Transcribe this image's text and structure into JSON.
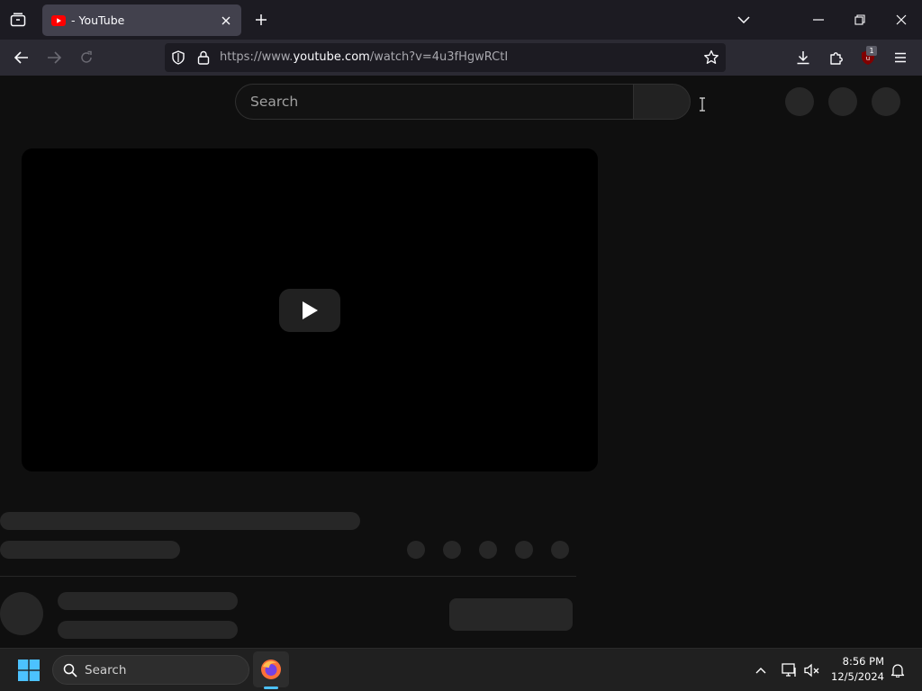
{
  "browser": {
    "tab": {
      "title": "- YouTube"
    },
    "url": {
      "scheme": "https://www.",
      "host": "youtube.com",
      "path": "/watch?v=4u3fHgwRCtI"
    },
    "extension_badge": "1"
  },
  "youtube": {
    "search_placeholder": "Search"
  },
  "taskbar": {
    "search_label": "Search",
    "time": "8:56 PM",
    "date": "12/5/2024"
  },
  "colors": {
    "accent_youtube": "#ff0000",
    "firefox_orange": "#ff7139",
    "windows_blue": "#4cc2ff"
  }
}
